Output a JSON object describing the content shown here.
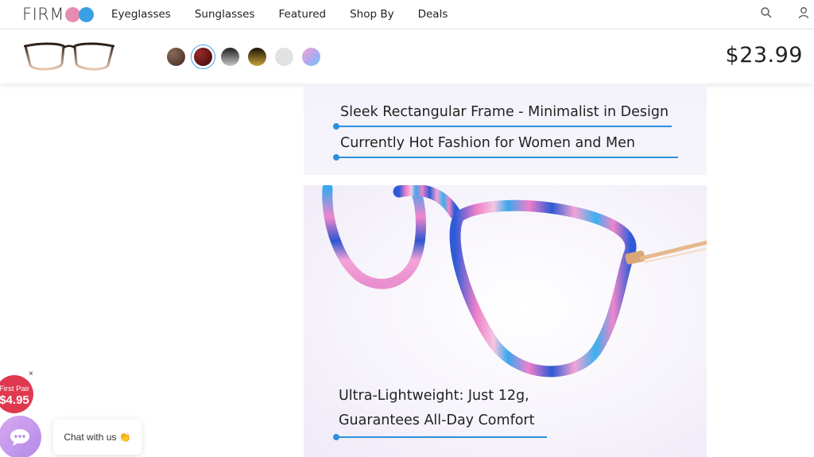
{
  "brand": {
    "name": "FIRM"
  },
  "nav": {
    "links": [
      "Eyeglasses",
      "Sunglasses",
      "Featured",
      "Shop By",
      "Deals"
    ],
    "icons": [
      "search-icon",
      "user-icon"
    ]
  },
  "product": {
    "price": "$23.99",
    "swatches": [
      {
        "name": "dark-brown",
        "color": "#5a3a2e",
        "selected": false
      },
      {
        "name": "burgundy",
        "color": "#6b0f14",
        "selected": true
      },
      {
        "name": "black-gray-gradient",
        "color": "#3a3a3a",
        "selected": false
      },
      {
        "name": "black-gold",
        "color": "#6b4e12",
        "selected": false
      },
      {
        "name": "light-gray",
        "color": "#e2e2e2",
        "selected": false
      },
      {
        "name": "pink-blue",
        "color": "#b7a6ec",
        "selected": false
      }
    ]
  },
  "features": {
    "line1": "Sleek Rectangular Frame - Minimalist in Design",
    "line2": "Currently Hot Fashion for Women and Men",
    "line3": "Ultra-Lightweight: Just 12g,",
    "line4": "Guarantees All-Day Comfort"
  },
  "promo": {
    "label": "First Pair",
    "price": "$4.95",
    "close": "×"
  },
  "chat": {
    "label": "Chat with us 👏"
  },
  "colors": {
    "accent": "#2e8fdb",
    "promo": "#e0384f",
    "chat": "#c79cee"
  }
}
